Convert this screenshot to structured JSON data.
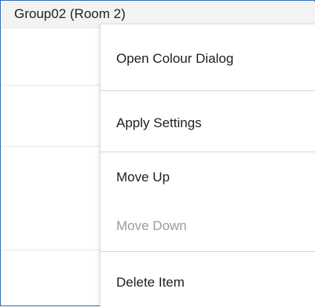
{
  "panel": {
    "group_title": "Group02 (Room 2)"
  },
  "context_menu": {
    "items": [
      {
        "label": "Open Colour Dialog",
        "enabled": true
      },
      {
        "label": "Apply Settings",
        "enabled": true
      },
      {
        "label": "Move Up",
        "enabled": true
      },
      {
        "label": "Move Down",
        "enabled": false
      },
      {
        "label": "Delete Item",
        "enabled": true
      }
    ]
  },
  "colors": {
    "frame_border": "#2f6fb6",
    "disabled_text": "#9c9c9c"
  }
}
